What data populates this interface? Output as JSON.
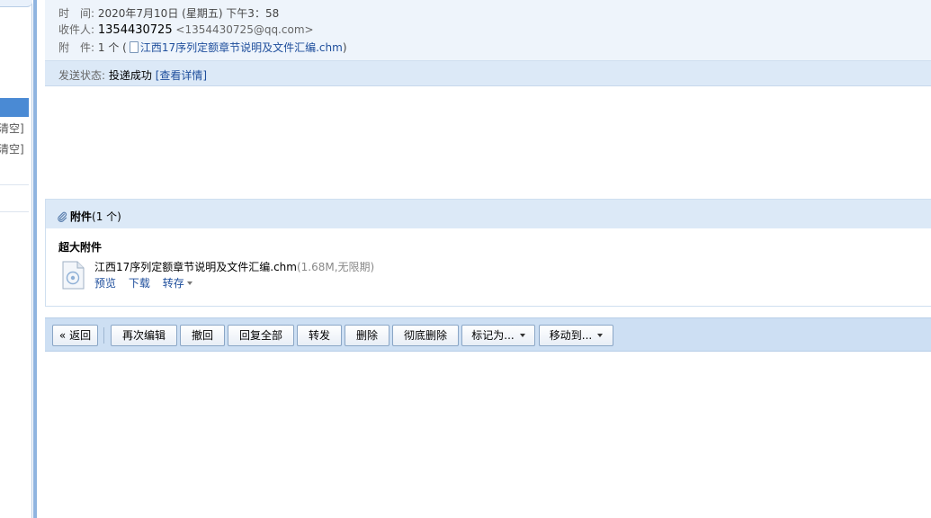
{
  "sidebar": {
    "clear_label_1": "清空]",
    "clear_label_2": "清空]"
  },
  "header": {
    "time_label": "时　间:",
    "time_value": "2020年7月10日 (星期五) 下午3：58",
    "recipient_label": "收件人:",
    "recipient_name": "1354430725",
    "recipient_email": "<1354430725@qq.com>",
    "attachment_label": "附　件:",
    "attachment_count": "1 个 (",
    "attachment_filename": "江西17序列定额章节说明及文件汇编.chm",
    "attachment_close": ")",
    "status_label": "发送状态:",
    "status_value": "投递成功",
    "status_details": "[查看详情]"
  },
  "attachments": {
    "title": "附件",
    "count": "(1 个)",
    "section": "超大附件",
    "file": {
      "name": "江西17序列定额章节说明及文件汇编.chm",
      "meta": "(1.68M,无限期)",
      "actions": {
        "preview": "预览",
        "download": "下载",
        "save": "转存"
      }
    }
  },
  "toolbar": {
    "back": "« 返回",
    "edit_again": "再次编辑",
    "recall": "撤回",
    "reply_all": "回复全部",
    "forward": "转发",
    "delete": "删除",
    "delete_permanently": "彻底删除",
    "mark_as": "标记为...",
    "move_to": "移动到..."
  },
  "colors": {
    "accent": "#4a8ad4",
    "link": "#1e4e9c",
    "header_bg": "#eef4fb",
    "toolbar_bg": "#cddff3"
  }
}
